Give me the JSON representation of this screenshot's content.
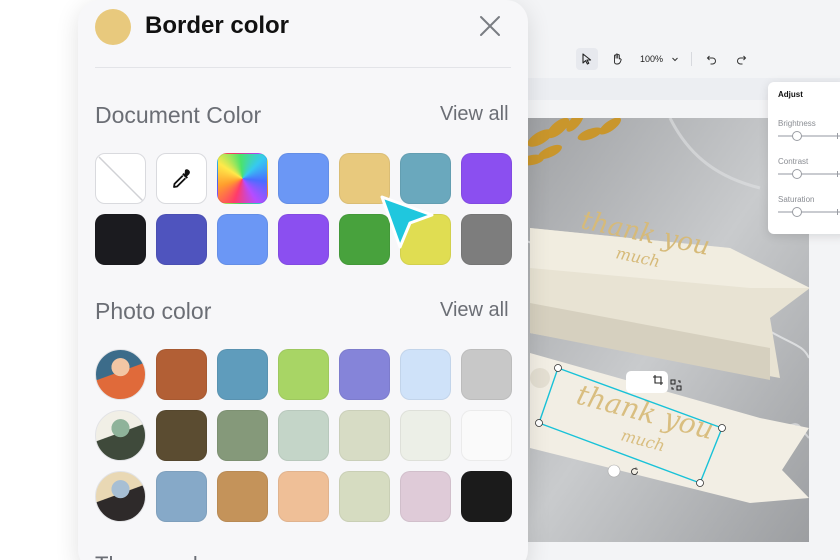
{
  "editor": {
    "zoom_label": "100%",
    "adjust": {
      "title": "Adjust",
      "sliders": [
        {
          "label": "Brightness",
          "value": 0.3
        },
        {
          "label": "Contrast",
          "value": 0.3
        },
        {
          "label": "Saturation",
          "value": 0.3
        }
      ]
    },
    "tag_text_1": "thank you",
    "tag_text_2": "much"
  },
  "panel": {
    "title": "Border color",
    "current_color": "#e8c97d",
    "document_section": {
      "title": "Document Color",
      "view_all": "View all",
      "swatches": [
        {
          "kind": "none"
        },
        {
          "kind": "picker",
          "icon": "eyedropper-icon"
        },
        {
          "kind": "gradient"
        },
        {
          "kind": "solid",
          "color": "#6b97f5"
        },
        {
          "kind": "solid",
          "color": "#e8c97d"
        },
        {
          "kind": "solid",
          "color": "#6aa8bd"
        },
        {
          "kind": "solid",
          "color": "#8b4ff0"
        },
        {
          "kind": "solid",
          "color": "#1b1b1f"
        },
        {
          "kind": "solid",
          "color": "#4f54be"
        },
        {
          "kind": "solid",
          "color": "#6b97f5"
        },
        {
          "kind": "solid",
          "color": "#8b4ff0"
        },
        {
          "kind": "solid",
          "color": "#48a23d"
        },
        {
          "kind": "solid",
          "color": "#e0dd52"
        },
        {
          "kind": "solid",
          "color": "#7d7d7d"
        }
      ]
    },
    "photo_section": {
      "title": "Photo color",
      "view_all": "View all",
      "rows": [
        {
          "photo_colors": [
            "#f2c6a4",
            "#3c6c8a",
            "#e06a3a"
          ],
          "swatches": [
            "#b25f35",
            "#5f9cbc",
            "#a8d565",
            "#8584d9",
            "#cfe2f9",
            "#c8c8c8"
          ]
        },
        {
          "photo_colors": [
            "#8fb39a",
            "#f1efe6",
            "#3f4a3b"
          ],
          "swatches": [
            "#5b4c31",
            "#85997a",
            "#c4d5c8",
            "#d7dcc5",
            "#ecefe7",
            "#fafafa"
          ]
        },
        {
          "photo_colors": [
            "#a7bfd4",
            "#e9d8b4",
            "#2e2a2a"
          ],
          "swatches": [
            "#86a9c8",
            "#c4935a",
            "#efbf97",
            "#d6dcc1",
            "#dfcbd8",
            "#1b1b1b"
          ]
        }
      ]
    },
    "next_section_title": "Theme color"
  }
}
